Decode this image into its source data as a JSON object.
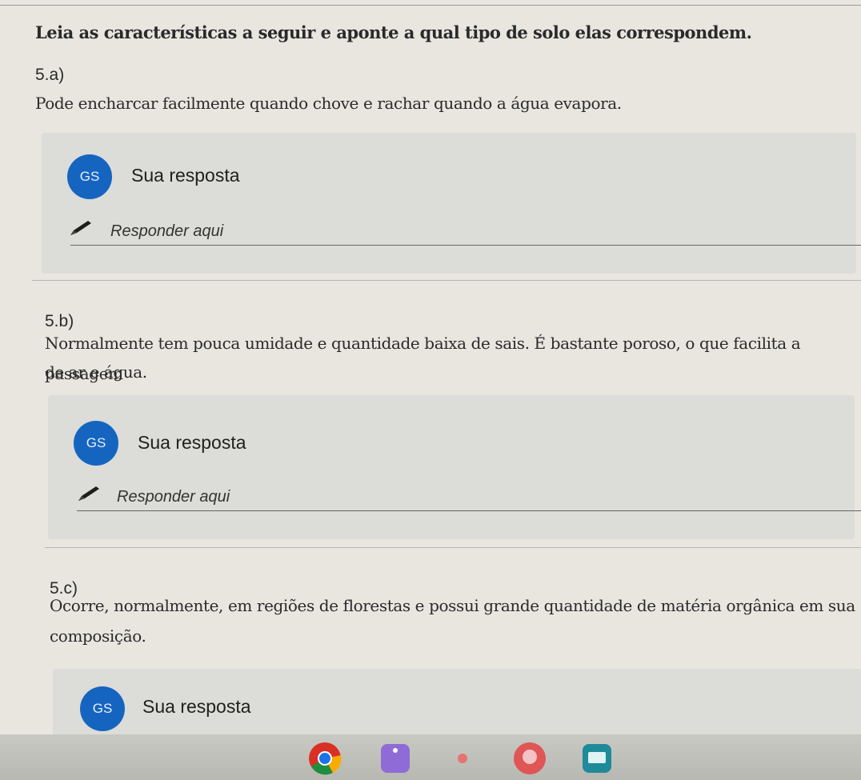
{
  "instruction": "Leia as características a seguir e aponte a qual tipo de solo elas correspondem.",
  "questions": [
    {
      "label": "5.a)",
      "lines": [
        "Pode encharcar facilmente quando chove e rachar quando a água evapora."
      ]
    },
    {
      "label": "5.b)",
      "lines": [
        "Normalmente tem pouca umidade e quantidade baixa de sais. É bastante poroso, o que facilita a passagem",
        "de ar e água."
      ]
    },
    {
      "label": "5.c)",
      "lines": [
        "Ocorre, normalmente, em regiões de florestas e possui grande quantidade de matéria orgânica em sua",
        "composição."
      ]
    }
  ],
  "answer": {
    "avatar_initials": "GS",
    "heading": "Sua resposta",
    "placeholder": "Responder aqui"
  },
  "colors": {
    "avatar": "#1565c0",
    "answer_box": "#dcdcd8"
  },
  "taskbar": {
    "icons": [
      "chrome-icon",
      "app-icon",
      "app-small-icon",
      "app-red-icon",
      "app-teal-icon"
    ]
  }
}
